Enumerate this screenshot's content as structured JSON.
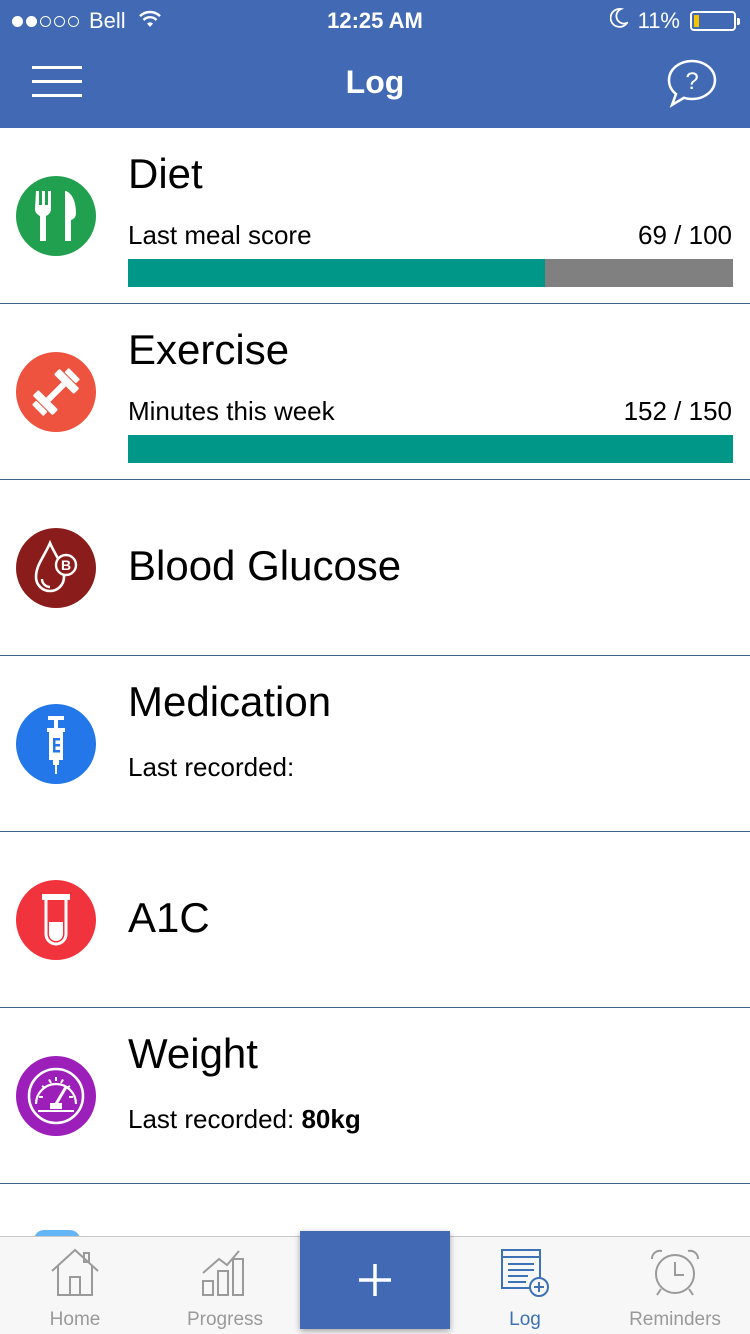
{
  "status_bar": {
    "carrier": "Bell",
    "time": "12:25 AM",
    "battery": "11%"
  },
  "nav": {
    "title": "Log"
  },
  "rows": [
    {
      "title": "Diet",
      "subtitle": "Last meal score",
      "value": "69 / 100",
      "progress": 0.69,
      "icon": "fork-knife-icon",
      "color": "#21a04f"
    },
    {
      "title": "Exercise",
      "subtitle": "Minutes this week",
      "value": "152 / 150",
      "progress": 1.0,
      "icon": "dumbbell-icon",
      "color": "#ee5340"
    },
    {
      "title": "Blood Glucose",
      "icon": "blood-drop-icon",
      "color": "#8b1c1c"
    },
    {
      "title": "Medication",
      "subtitle": "Last recorded:",
      "icon": "syringe-icon",
      "color": "#2377e8"
    },
    {
      "title": "A1C",
      "icon": "test-tube-icon",
      "color": "#f0333c"
    },
    {
      "title": "Weight",
      "subtitle": "Last recorded: ",
      "subtitle_value": "80kg",
      "icon": "scale-gauge-icon",
      "color": "#9b1fb8"
    }
  ],
  "progress_colors": {
    "fill": "#009688",
    "track": "#808080"
  },
  "tabs": [
    {
      "label": "Home",
      "icon": "home-icon"
    },
    {
      "label": "Progress",
      "icon": "bar-chart-icon"
    },
    {
      "label": "Log",
      "icon": "log-list-icon",
      "active": true
    },
    {
      "label": "Reminders",
      "icon": "alarm-clock-icon"
    }
  ],
  "accent": "#4169b4"
}
